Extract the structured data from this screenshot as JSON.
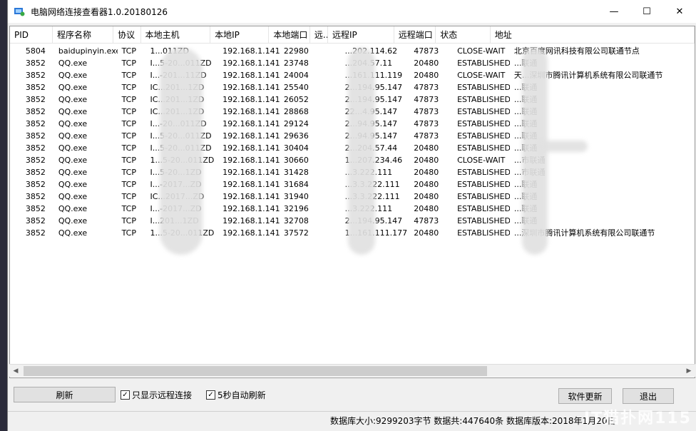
{
  "window": {
    "title": "电脑网络连接查看器1.0.20180126",
    "minimize": "—",
    "maximize": "☐",
    "close": "✕"
  },
  "columns": [
    "PID",
    "程序名称",
    "协议",
    "本地主机",
    "本地IP",
    "本地端口",
    "远...",
    "远程IP",
    "远程端口",
    "状态",
    "地址"
  ],
  "rows": [
    {
      "pid": "5804",
      "name": "baidupinyin.exe",
      "proto": "TCP",
      "host": "1...011ZD",
      "lip": "192.168.1.141",
      "lport": "22980",
      "rr": "",
      "rip": "...202.114.62",
      "rport": "47873",
      "state": "CLOSE-WAIT",
      "addr": "北京百度网讯科技有限公司联通节点"
    },
    {
      "pid": "3852",
      "name": "QQ.exe",
      "proto": "TCP",
      "host": "I...5-20...011ZD",
      "lip": "192.168.1.141",
      "lport": "23748",
      "rr": "",
      "rip": "...204.57.11",
      "rport": "20480",
      "state": "ESTABLISHED",
      "addr": "...联通"
    },
    {
      "pid": "3852",
      "name": "QQ.exe",
      "proto": "TCP",
      "host": "I...-201...11ZD",
      "lip": "192.168.1.141",
      "lport": "24004",
      "rr": "",
      "rip": "...161.111.119",
      "rport": "20480",
      "state": "CLOSE-WAIT",
      "addr": "天...深圳市腾讯计算机系统有限公司联通节"
    },
    {
      "pid": "3852",
      "name": "QQ.exe",
      "proto": "TCP",
      "host": "IC...201...1ZD",
      "lip": "192.168.1.141",
      "lport": "25540",
      "rr": "",
      "rip": "2...194.95.147",
      "rport": "47873",
      "state": "ESTABLISHED",
      "addr": "...联通"
    },
    {
      "pid": "3852",
      "name": "QQ.exe",
      "proto": "TCP",
      "host": "IC...201...1ZD",
      "lip": "192.168.1.141",
      "lport": "26052",
      "rr": "",
      "rip": "2...194.95.147",
      "rport": "47873",
      "state": "ESTABLISHED",
      "addr": "...联通"
    },
    {
      "pid": "3852",
      "name": "QQ.exe",
      "proto": "TCP",
      "host": "IC...201...1ZD",
      "lip": "192.168.1.141",
      "lport": "28868",
      "rr": "",
      "rip": "22...4.95.147",
      "rport": "47873",
      "state": "ESTABLISHED",
      "addr": "...联通"
    },
    {
      "pid": "3852",
      "name": "QQ.exe",
      "proto": "TCP",
      "host": "I...-20...011ZD",
      "lip": "192.168.1.141",
      "lport": "29124",
      "rr": "",
      "rip": "2...94.95.147",
      "rport": "47873",
      "state": "ESTABLISHED",
      "addr": "...联通"
    },
    {
      "pid": "3852",
      "name": "QQ.exe",
      "proto": "TCP",
      "host": "I...5-20...011ZD",
      "lip": "192.168.1.141",
      "lport": "29636",
      "rr": "",
      "rip": "2...94.95.147",
      "rport": "47873",
      "state": "ESTABLISHED",
      "addr": "...联通"
    },
    {
      "pid": "3852",
      "name": "QQ.exe",
      "proto": "TCP",
      "host": "I...5-20...011ZD",
      "lip": "192.168.1.141",
      "lport": "30404",
      "rr": "",
      "rip": "2...204.57.44",
      "rport": "20480",
      "state": "ESTABLISHED",
      "addr": "...联通"
    },
    {
      "pid": "3852",
      "name": "QQ.exe",
      "proto": "TCP",
      "host": "1...5-20...011ZD",
      "lip": "192.168.1.141",
      "lport": "30660",
      "rr": "",
      "rip": "1...207.234.46",
      "rport": "20480",
      "state": "CLOSE-WAIT",
      "addr": "...市联通"
    },
    {
      "pid": "3852",
      "name": "QQ.exe",
      "proto": "TCP",
      "host": "I...5-20...1ZD",
      "lip": "192.168.1.141",
      "lport": "31428",
      "rr": "",
      "rip": "...3.222.111",
      "rport": "20480",
      "state": "ESTABLISHED",
      "addr": "...市联通"
    },
    {
      "pid": "3852",
      "name": "QQ.exe",
      "proto": "TCP",
      "host": "I...-2017...ZD",
      "lip": "192.168.1.141",
      "lport": "31684",
      "rr": "",
      "rip": "...3.3.222.111",
      "rport": "20480",
      "state": "ESTABLISHED",
      "addr": "...联通"
    },
    {
      "pid": "3852",
      "name": "QQ.exe",
      "proto": "TCP",
      "host": "IC...2017...ZD",
      "lip": "192.168.1.141",
      "lport": "31940",
      "rr": "",
      "rip": "...3.3.222.111",
      "rport": "20480",
      "state": "ESTABLISHED",
      "addr": "...联通"
    },
    {
      "pid": "3852",
      "name": "QQ.exe",
      "proto": "TCP",
      "host": "I...-2017...ZD",
      "lip": "192.168.1.141",
      "lport": "32196",
      "rr": "",
      "rip": "...3.222.111",
      "rport": "20480",
      "state": "ESTABLISHED",
      "addr": "...联通"
    },
    {
      "pid": "3852",
      "name": "QQ.exe",
      "proto": "TCP",
      "host": "I...201...1ZD",
      "lip": "192.168.1.141",
      "lport": "32708",
      "rr": "",
      "rip": "2...194.95.147",
      "rport": "47873",
      "state": "ESTABLISHED",
      "addr": "...联通"
    },
    {
      "pid": "3852",
      "name": "QQ.exe",
      "proto": "TCP",
      "host": "1...5-20...011ZD",
      "lip": "192.168.1.141",
      "lport": "37572",
      "rr": "",
      "rip": "1...161.111.177",
      "rport": "20480",
      "state": "ESTABLISHED",
      "addr": "...深圳市腾讯计算机系统有限公司联通节"
    }
  ],
  "controls": {
    "refresh": "刷新",
    "remote_only_label": "只显示远程连接",
    "auto_refresh_label": "5秒自动刷新",
    "update": "软件更新",
    "exit": "退出",
    "check": "✓"
  },
  "status": {
    "text": "数据库大小:9299203字节  数据共:447640条  数据库版本:2018年1月20日"
  },
  "watermark": "IT猫扑网115"
}
